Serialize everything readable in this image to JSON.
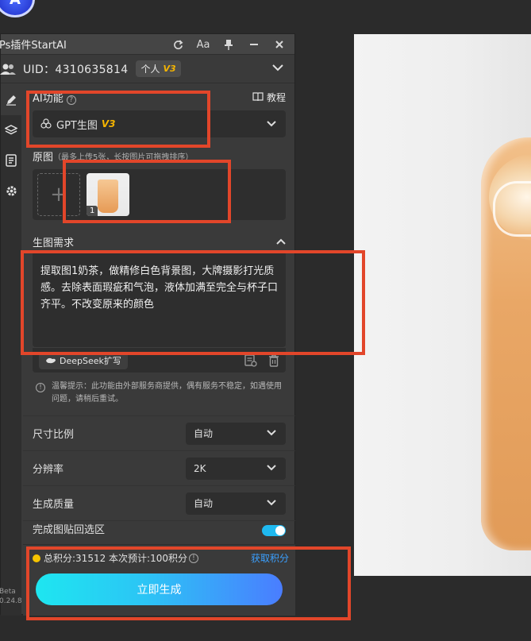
{
  "app": {
    "title": "Ps插件StartAI",
    "logo_icon": "startai-logo-icon"
  },
  "titlebar_icons": [
    "refresh-icon",
    "font-size-icon",
    "pin-icon",
    "minimize-icon",
    "close-icon"
  ],
  "titlebar_font_label": "Aa",
  "user": {
    "uid_text": "UID：4310635814",
    "tier_label": "个人",
    "tier_badge": "V3"
  },
  "ai_function": {
    "label": "AI功能",
    "tutorial_label": "教程",
    "selected": "GPT生图",
    "selected_badge": "V3"
  },
  "source_image": {
    "label": "原图",
    "hint": "（最多上传5张，长按图片可拖拽排序）",
    "add_symbol": "+",
    "thumb_index": "1"
  },
  "requirement": {
    "label": "生图需求",
    "text": "提取图1奶茶，做精修白色背景图，大牌摄影打光质感。去除表面瑕疵和气泡，液体加满至完全与杯子口齐平。不改变原来的颜色",
    "deepseek_label": "DeepSeek扩写"
  },
  "notice": "温馨提示：此功能由外部服务商提供，偶有服务不稳定，如遇使用问题，请稍后重试。",
  "options": [
    {
      "label": "尺寸比例",
      "value": "自动"
    },
    {
      "label": "分辨率",
      "value": "2K"
    },
    {
      "label": "生成质量",
      "value": "自动"
    }
  ],
  "partial_option_label": "完成图贴回选区",
  "footer": {
    "points_text": "总积分:31512  本次预计:100积分",
    "get_points": "获取积分",
    "generate_button": "立即生成"
  },
  "sidebar": {
    "items": [
      "edit-icon",
      "layers-icon",
      "history-icon",
      "settings-icon"
    ],
    "beta": "Beta",
    "version": "0.24.8"
  },
  "colors": {
    "accent_blue": "#3aa0ff",
    "badge_gold": "#f5b400",
    "annotation_red": "#e2462a",
    "button_gradient_start": "#1ee6f0",
    "button_gradient_end": "#4a7dff"
  }
}
